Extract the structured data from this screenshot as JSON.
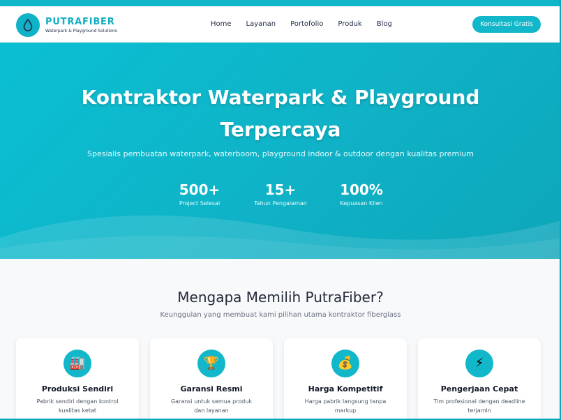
{
  "brand": {
    "name": "PUTRAFIBER",
    "tagline": "Waterpark & Playground Solutions",
    "icon": "water-drop-icon",
    "accent": "#11b5c8"
  },
  "nav": {
    "items": [
      "Home",
      "Layanan",
      "Portofolio",
      "Produk",
      "Blog"
    ],
    "cta": "Konsultasi Gratis"
  },
  "hero": {
    "title_line1": "Kontraktor Waterpark & Playground",
    "title_line2": "Terpercaya",
    "subtitle": "Spesialis pembuatan waterpark, waterboom, playground indoor & outdoor dengan kualitas premium",
    "stats": [
      {
        "value": "500+",
        "label": "Project Selesai"
      },
      {
        "value": "15+",
        "label": "Tahun Pengalaman"
      },
      {
        "value": "100%",
        "label": "Kepuasan Klien"
      }
    ]
  },
  "why": {
    "title": "Mengapa Memilih PutraFiber?",
    "subtitle": "Keunggulan yang membuat kami pilihan utama kontraktor fiberglass",
    "cards": [
      {
        "icon": "factory-icon",
        "glyph": "🏭",
        "title": "Produksi Sendiri",
        "desc": "Pabrik sendiri dengan kontrol kualitas ketat"
      },
      {
        "icon": "trophy-icon",
        "glyph": "🏆",
        "title": "Garansi Resmi",
        "desc": "Garansi untuk semua produk dan layanan"
      },
      {
        "icon": "money-bag-icon",
        "glyph": "💰",
        "title": "Harga Kompetitif",
        "desc": "Harga pabrik langsung tanpa markup"
      },
      {
        "icon": "lightning-icon",
        "glyph": "⚡",
        "title": "Pengerjaan Cepat",
        "desc": "Tim profesional dengan deadline terjamin"
      }
    ]
  }
}
